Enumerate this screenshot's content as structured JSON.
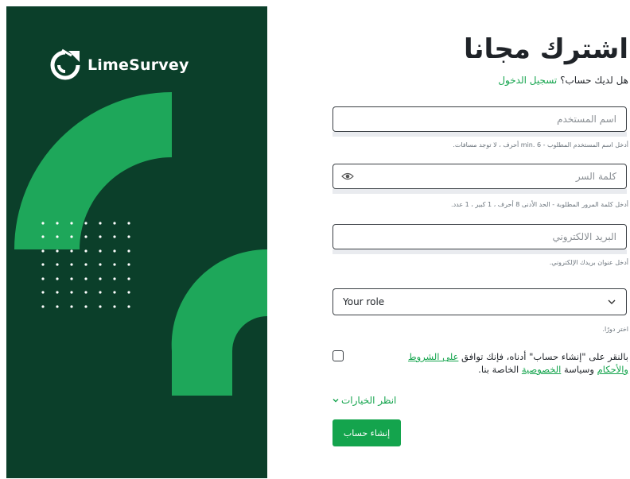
{
  "brand": {
    "name": "LimeSurvey",
    "colors": {
      "panel": "#0b3f2a",
      "accent": "#1ea75a",
      "dots": "#ffffff"
    }
  },
  "form": {
    "title": "اشترك مجانا",
    "login_prompt": "هل لديك حساب؟",
    "login_link": "تسجيل الدخول",
    "username": {
      "placeholder": "اسم المستخدم",
      "hint": "أدخل اسم المستخدم المطلوب - min. 6 أحرف ، لا توجد مسافات."
    },
    "password": {
      "placeholder": "كلمة السر",
      "hint": "أدخل كلمة المرور المطلوبة - الحد الأدنى 8 أحرف ، 1 كبير ، 1 عدد.",
      "toggle_icon": "eye-icon"
    },
    "email": {
      "placeholder": "البريد الالكتروني",
      "hint": "أدخل عنوان بريدك الإلكتروني."
    },
    "role": {
      "value": "Your role",
      "hint": "اختر دورًا."
    },
    "terms": {
      "before": "بالنقر على \"إنشاء حساب\" أدناه، فإنك توافق ",
      "terms_link": "على الشروط والأحكام",
      "middle": " وسياسة ",
      "privacy_link": "الخصوصية",
      "after": " الخاصة بنا."
    },
    "options_label": "انظر الخيارات",
    "submit_label": "إنشاء حساب",
    "accent": "#14a44d"
  }
}
